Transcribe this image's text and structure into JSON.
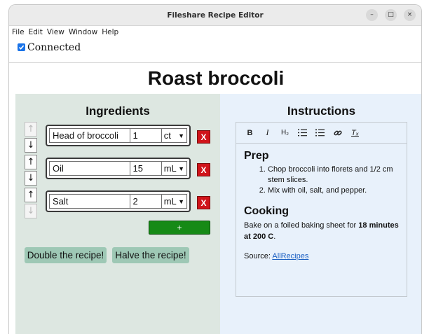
{
  "window": {
    "title": "Fileshare Recipe Editor",
    "controls": {
      "minimize": "–",
      "maximize": "□",
      "close": "×"
    }
  },
  "menu": [
    "File",
    "Edit",
    "View",
    "Window",
    "Help"
  ],
  "connection": {
    "label": "Connected",
    "checked": true
  },
  "recipe": {
    "title": "Roast broccoli",
    "ingredients_heading": "Ingredients",
    "instructions_heading": "Instructions",
    "ingredients": [
      {
        "name": "Head of broccoli",
        "qty": "1",
        "unit": "ct",
        "up_disabled": true,
        "down_disabled": false
      },
      {
        "name": "Oil",
        "qty": "15",
        "unit": "mL",
        "up_disabled": false,
        "down_disabled": false
      },
      {
        "name": "Salt",
        "qty": "2",
        "unit": "mL",
        "up_disabled": false,
        "down_disabled": true
      }
    ],
    "labels": {
      "up": "↑",
      "down": "↓",
      "delete": "X",
      "add": "+",
      "double": "Double the recipe!",
      "halve": "Halve the recipe!"
    },
    "colors": {
      "delete": "#d0141a",
      "add": "#168a16",
      "left_pane": "#dde7e1",
      "right_pane": "#e8f1fb",
      "scale_buttons": "#9ec8b5"
    }
  },
  "editor": {
    "toolbar": [
      {
        "icon": "bold-icon",
        "glyph": "B"
      },
      {
        "icon": "italic-icon",
        "glyph": "I"
      },
      {
        "icon": "heading-icon",
        "glyph": "H₂"
      },
      {
        "icon": "ordered-list-icon",
        "glyph": "⋮≡"
      },
      {
        "icon": "bullet-list-icon",
        "glyph": "≔"
      },
      {
        "icon": "link-icon",
        "glyph": "🔗"
      },
      {
        "icon": "clear-format-icon",
        "glyph": "Tₓ"
      }
    ],
    "prep_heading": "Prep",
    "prep_steps": [
      "Chop broccoli into florets and 1/2 cm stem slices.",
      "Mix with oil, salt, and pepper."
    ],
    "cooking_heading": "Cooking",
    "cooking_text": "Bake on a foiled baking sheet for ",
    "cooking_bold": "18 minutes at 200 C",
    "cooking_end": ".",
    "source_label": "Source: ",
    "source_link": "AllRecipes"
  }
}
